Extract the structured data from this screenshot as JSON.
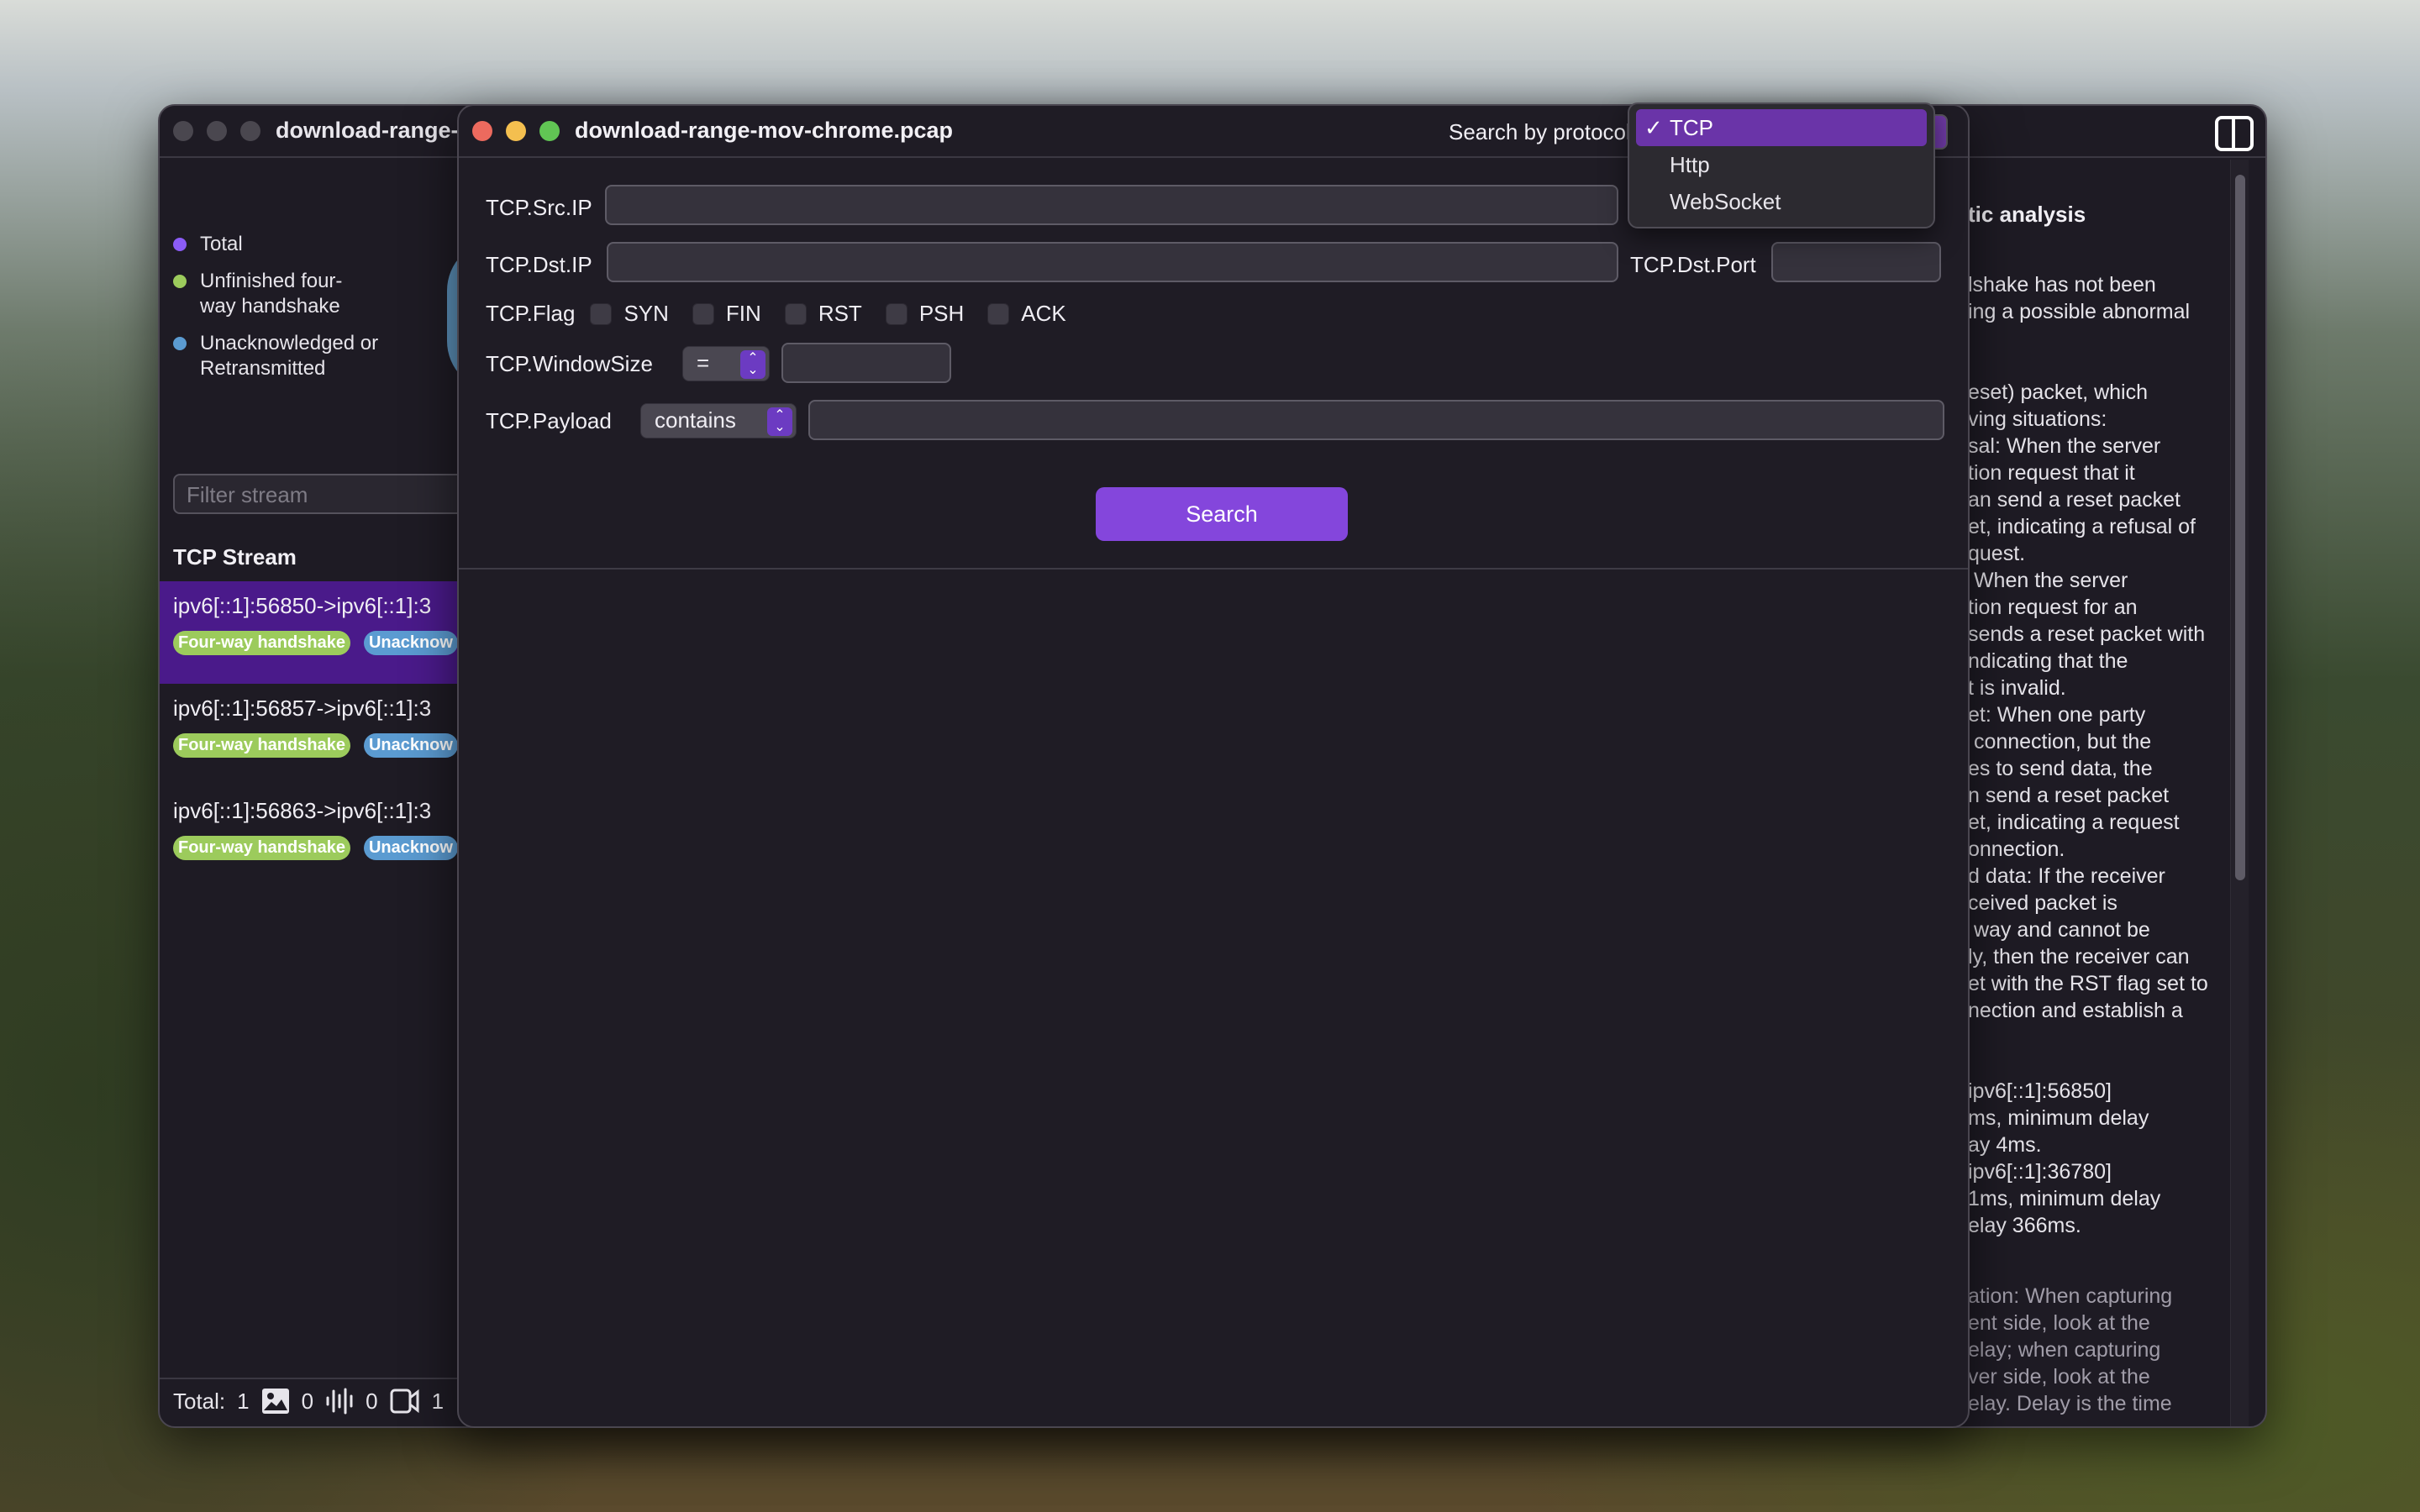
{
  "background_window": {
    "title": "download-range-mov-chrome.pcap",
    "legend": [
      {
        "label": "Total",
        "color": "#8b5cf6"
      },
      {
        "label": "Unfinished four-way handshake",
        "color": "#9ccb5c"
      },
      {
        "label": "Unacknowledged or Retransmitted",
        "color": "#5b9bd1"
      }
    ],
    "filter_placeholder": "Filter stream",
    "stream_heading": "TCP Stream",
    "streams": [
      {
        "address": "ipv6[::1]:56850->ipv6[::1]:3",
        "tags": [
          "Four-way handshake",
          "Unacknow"
        ],
        "selected": true
      },
      {
        "address": "ipv6[::1]:56857->ipv6[::1]:3",
        "tags": [
          "Four-way handshake",
          "Unacknow"
        ],
        "selected": false
      },
      {
        "address": "ipv6[::1]:56863->ipv6[::1]:3",
        "tags": [
          "Four-way handshake",
          "Unacknow"
        ],
        "selected": false
      }
    ],
    "footer": {
      "total_label": "Total:",
      "total_value": "1",
      "image_count": "0",
      "audio_count": "0",
      "video_count": "1"
    },
    "analysis": {
      "heading": "tic analysis",
      "paragraph1": "lshake has not been\ning a possible abnormal",
      "paragraph2": "eset) packet, which\nving situations:\nsal: When the server\ntion request that it\nan send a reset packet\net, indicating a refusal of\nquest.\n When the server\ntion request for an\nsends a reset packet with\nndicating that the\nt is invalid.\net: When one party\n connection, but the\nes to send data, the\nn send a reset packet\net, indicating a request\nonnection.\nd data: If the receiver\nceived packet is\n way and cannot be\nly, then the receiver can\net with the RST flag set to\nnection and establish a",
      "paragraph3": "ipv6[::1]:56850]\nms, minimum delay\nay 4ms.\nipv6[::1]:36780]\n1ms, minimum delay\nelay 366ms.",
      "paragraph4": "ation: When capturing\nent side, look at the\nelay; when capturing\nver side, look at the\nelay. Delay is the time"
    }
  },
  "main_window": {
    "title": "download-range-mov-chrome.pcap",
    "protocol_label": "Search by protocol",
    "protocol_menu": {
      "options": [
        "TCP",
        "Http",
        "WebSocket"
      ],
      "selected": "TCP",
      "check_glyph": "✓"
    },
    "form": {
      "src_ip_label": "TCP.Src.IP",
      "src_ip_value": "",
      "dst_ip_label": "TCP.Dst.IP",
      "dst_ip_value": "",
      "dst_port_label": "TCP.Dst.Port",
      "dst_port_value": "",
      "flag_label": "TCP.Flag",
      "flags": [
        {
          "label": "SYN",
          "checked": false
        },
        {
          "label": "FIN",
          "checked": false
        },
        {
          "label": "RST",
          "checked": false
        },
        {
          "label": "PSH",
          "checked": false
        },
        {
          "label": "ACK",
          "checked": false
        }
      ],
      "window_size_label": "TCP.WindowSize",
      "window_size_operator": "=",
      "window_size_value": "",
      "payload_label": "TCP.Payload",
      "payload_operator": "contains",
      "payload_value": ""
    },
    "search_button": "Search"
  },
  "colors": {
    "accent": "#8446dc",
    "selected_stream": "#4a1a8a",
    "tag_green": "#9ccb5c",
    "tag_blue": "#5b9bd1"
  }
}
